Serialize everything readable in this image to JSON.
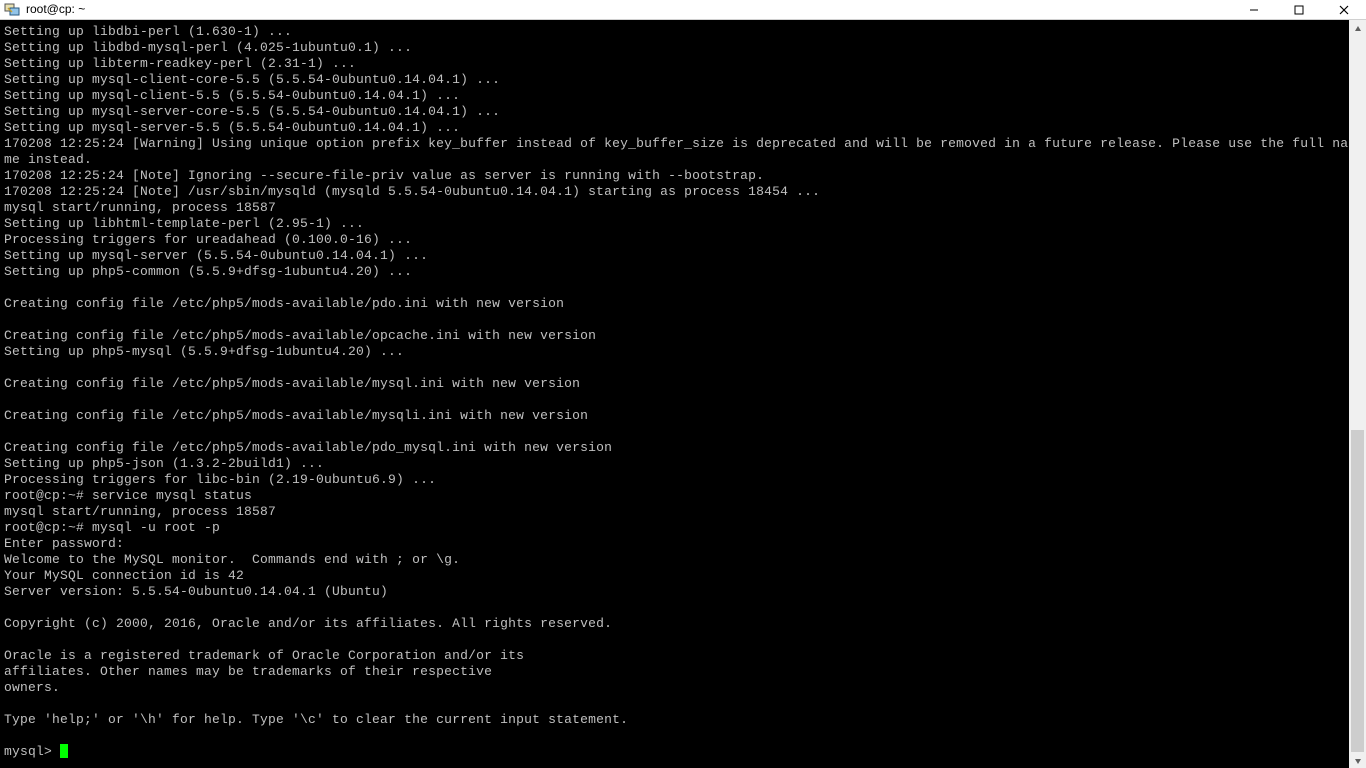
{
  "window": {
    "title": "root@cp: ~"
  },
  "scrollbar": {
    "thumb_top_pct": 55,
    "thumb_height_pct": 45
  },
  "lines": [
    "Setting up libdbi-perl (1.630-1) ...",
    "Setting up libdbd-mysql-perl (4.025-1ubuntu0.1) ...",
    "Setting up libterm-readkey-perl (2.31-1) ...",
    "Setting up mysql-client-core-5.5 (5.5.54-0ubuntu0.14.04.1) ...",
    "Setting up mysql-client-5.5 (5.5.54-0ubuntu0.14.04.1) ...",
    "Setting up mysql-server-core-5.5 (5.5.54-0ubuntu0.14.04.1) ...",
    "Setting up mysql-server-5.5 (5.5.54-0ubuntu0.14.04.1) ...",
    "170208 12:25:24 [Warning] Using unique option prefix key_buffer instead of key_buffer_size is deprecated and will be removed in a future release. Please use the full na",
    "me instead.",
    "170208 12:25:24 [Note] Ignoring --secure-file-priv value as server is running with --bootstrap.",
    "170208 12:25:24 [Note] /usr/sbin/mysqld (mysqld 5.5.54-0ubuntu0.14.04.1) starting as process 18454 ...",
    "mysql start/running, process 18587",
    "Setting up libhtml-template-perl (2.95-1) ...",
    "Processing triggers for ureadahead (0.100.0-16) ...",
    "Setting up mysql-server (5.5.54-0ubuntu0.14.04.1) ...",
    "Setting up php5-common (5.5.9+dfsg-1ubuntu4.20) ...",
    "",
    "Creating config file /etc/php5/mods-available/pdo.ini with new version",
    "",
    "Creating config file /etc/php5/mods-available/opcache.ini with new version",
    "Setting up php5-mysql (5.5.9+dfsg-1ubuntu4.20) ...",
    "",
    "Creating config file /etc/php5/mods-available/mysql.ini with new version",
    "",
    "Creating config file /etc/php5/mods-available/mysqli.ini with new version",
    "",
    "Creating config file /etc/php5/mods-available/pdo_mysql.ini with new version",
    "Setting up php5-json (1.3.2-2build1) ...",
    "Processing triggers for libc-bin (2.19-0ubuntu6.9) ...",
    "root@cp:~# service mysql status",
    "mysql start/running, process 18587",
    "root@cp:~# mysql -u root -p",
    "Enter password:",
    "Welcome to the MySQL monitor.  Commands end with ; or \\g.",
    "Your MySQL connection id is 42",
    "Server version: 5.5.54-0ubuntu0.14.04.1 (Ubuntu)",
    "",
    "Copyright (c) 2000, 2016, Oracle and/or its affiliates. All rights reserved.",
    "",
    "Oracle is a registered trademark of Oracle Corporation and/or its",
    "affiliates. Other names may be trademarks of their respective",
    "owners.",
    "",
    "Type 'help;' or '\\h' for help. Type '\\c' to clear the current input statement.",
    ""
  ],
  "prompt": "mysql> "
}
